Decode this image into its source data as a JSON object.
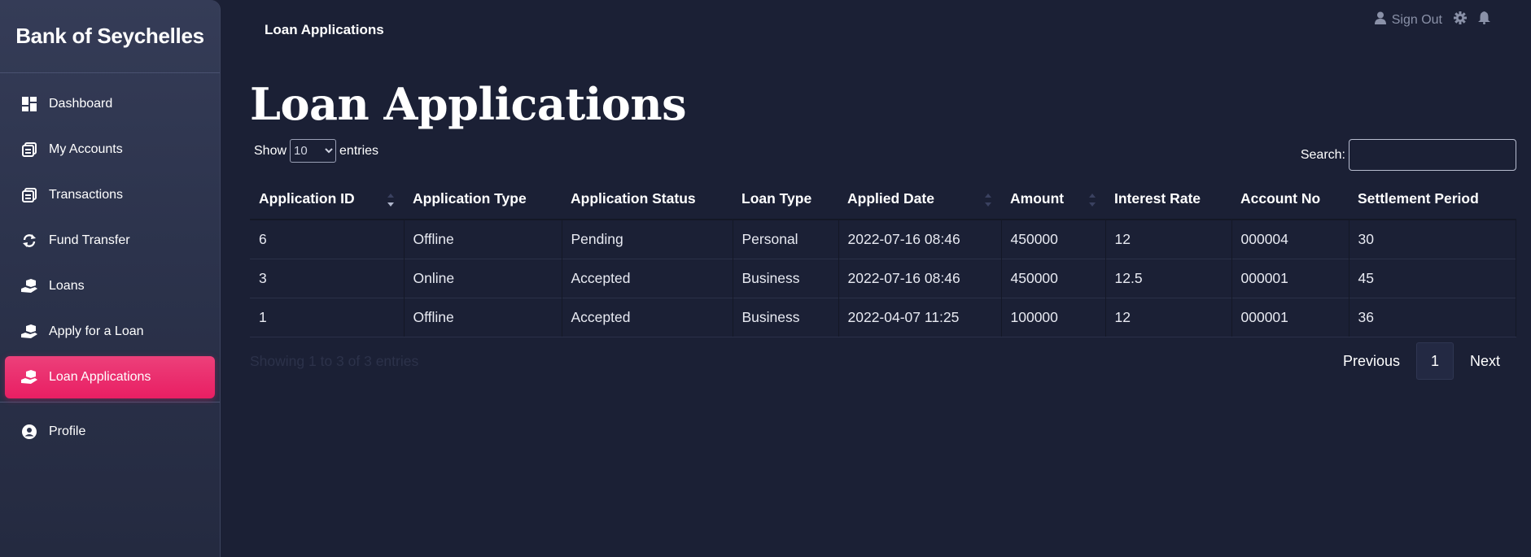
{
  "app": {
    "brand": "Bank of Seychelles"
  },
  "sidebar": {
    "items": [
      {
        "label": "Dashboard",
        "icon": "dashboard-icon"
      },
      {
        "label": "My Accounts",
        "icon": "accounts-icon"
      },
      {
        "label": "Transactions",
        "icon": "transactions-icon"
      },
      {
        "label": "Fund Transfer",
        "icon": "transfer-icon"
      },
      {
        "label": "Loans",
        "icon": "loan-hand-icon"
      },
      {
        "label": "Apply for a Loan",
        "icon": "loan-hand-icon"
      },
      {
        "label": "Loan Applications",
        "icon": "loan-hand-icon",
        "active": true
      }
    ],
    "profile": {
      "label": "Profile",
      "icon": "user-circle-icon"
    }
  },
  "header": {
    "breadcrumb": "Loan Applications",
    "sign_out": "Sign Out"
  },
  "main": {
    "title": "Loan Applications",
    "length": {
      "prefix": "Show",
      "value": "10",
      "suffix": "entries"
    },
    "search": {
      "label": "Search:",
      "value": ""
    },
    "table": {
      "columns": [
        "Application ID",
        "Application Type",
        "Application Status",
        "Loan Type",
        "Applied Date",
        "Amount",
        "Interest Rate",
        "Account No",
        "Settlement Period"
      ],
      "rows": [
        [
          "6",
          "Offline",
          "Pending",
          "Personal",
          "2022-07-16 08:46",
          "450000",
          "12",
          "000004",
          "30"
        ],
        [
          "3",
          "Online",
          "Accepted",
          "Business",
          "2022-07-16 08:46",
          "450000",
          "12.5",
          "000001",
          "45"
        ],
        [
          "1",
          "Offline",
          "Accepted",
          "Business",
          "2022-04-07 11:25",
          "100000",
          "12",
          "000001",
          "36"
        ]
      ]
    },
    "info": "Showing 1 to 3 of 3 entries",
    "pagination": {
      "previous": "Previous",
      "current": "1",
      "next": "Next"
    }
  },
  "colors": {
    "background": "#1b2035",
    "accent": "#e91e63",
    "sidebar": "#2c334c"
  }
}
